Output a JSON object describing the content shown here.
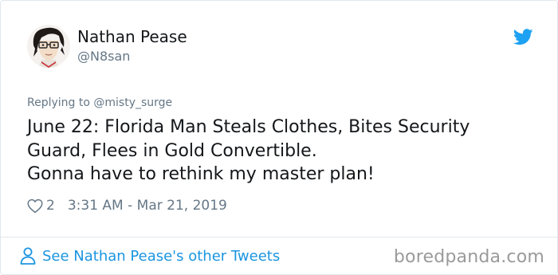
{
  "tweet": {
    "author": {
      "name": "Nathan Pease",
      "handle": "@N8san"
    },
    "replying_to": "Replying to @misty_surge",
    "text_lines": [
      "June 22: Florida Man Steals Clothes, Bites Security",
      "Guard, Flees in Gold Convertible.",
      "Gonna have to rethink my master plan!"
    ],
    "likes": "2",
    "timestamp": "3:31 AM - Mar 21, 2019"
  },
  "footer": {
    "see_more_label": "See Nathan Pease's other Tweets",
    "watermark": "boredpanda.com"
  },
  "icons": {
    "brand": "twitter-bird-icon",
    "like": "heart-icon",
    "profile": "person-icon"
  },
  "colors": {
    "twitter_blue": "#1da1f2",
    "link_blue": "#1b95e0",
    "text_primary": "#14171a",
    "text_secondary": "#657786",
    "border": "#e1e8ed",
    "watermark_gray": "#9a9a9a"
  }
}
